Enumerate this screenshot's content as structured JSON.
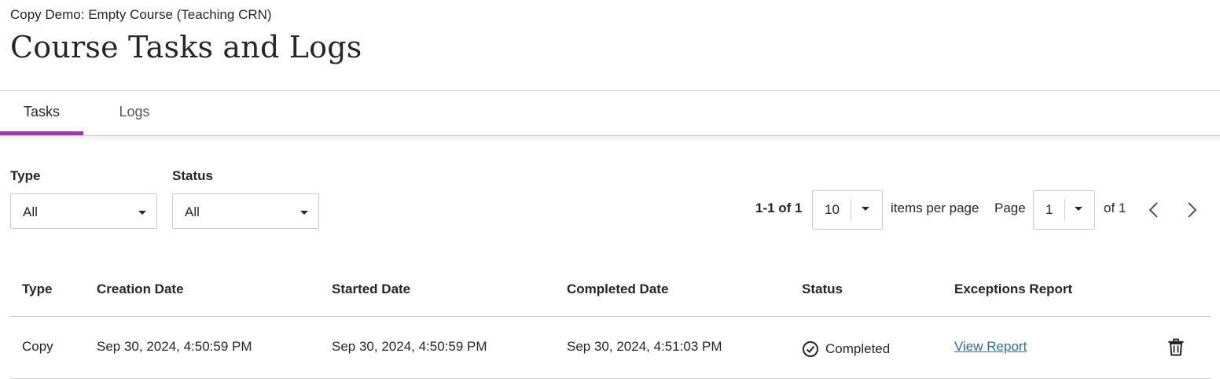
{
  "header": {
    "course_name": "Copy Demo: Empty Course (Teaching CRN)",
    "title": "Course Tasks and Logs"
  },
  "tabs": [
    {
      "label": "Tasks",
      "active": true
    },
    {
      "label": "Logs",
      "active": false
    }
  ],
  "filters": {
    "type": {
      "label": "Type",
      "value": "All"
    },
    "status": {
      "label": "Status",
      "value": "All"
    }
  },
  "pagination": {
    "range": "1-1 of 1",
    "per_page": "10",
    "per_page_label": "items per page",
    "page_label": "Page",
    "page": "1",
    "of_pages": "of 1"
  },
  "table": {
    "columns": [
      "Type",
      "Creation Date",
      "Started Date",
      "Completed Date",
      "Status",
      "Exceptions Report"
    ],
    "rows": [
      {
        "type": "Copy",
        "creation_date": "Sep 30, 2024, 4:50:59 PM",
        "started_date": "Sep 30, 2024, 4:50:59 PM",
        "completed_date": "Sep 30, 2024, 4:51:03 PM",
        "status": "Completed",
        "status_icon": "check-circle-icon",
        "report_link": "View Report",
        "action_icon": "trash-icon"
      }
    ]
  },
  "colors": {
    "accent": "#a234b5",
    "link": "#2a6fa0",
    "text": "#262626"
  }
}
